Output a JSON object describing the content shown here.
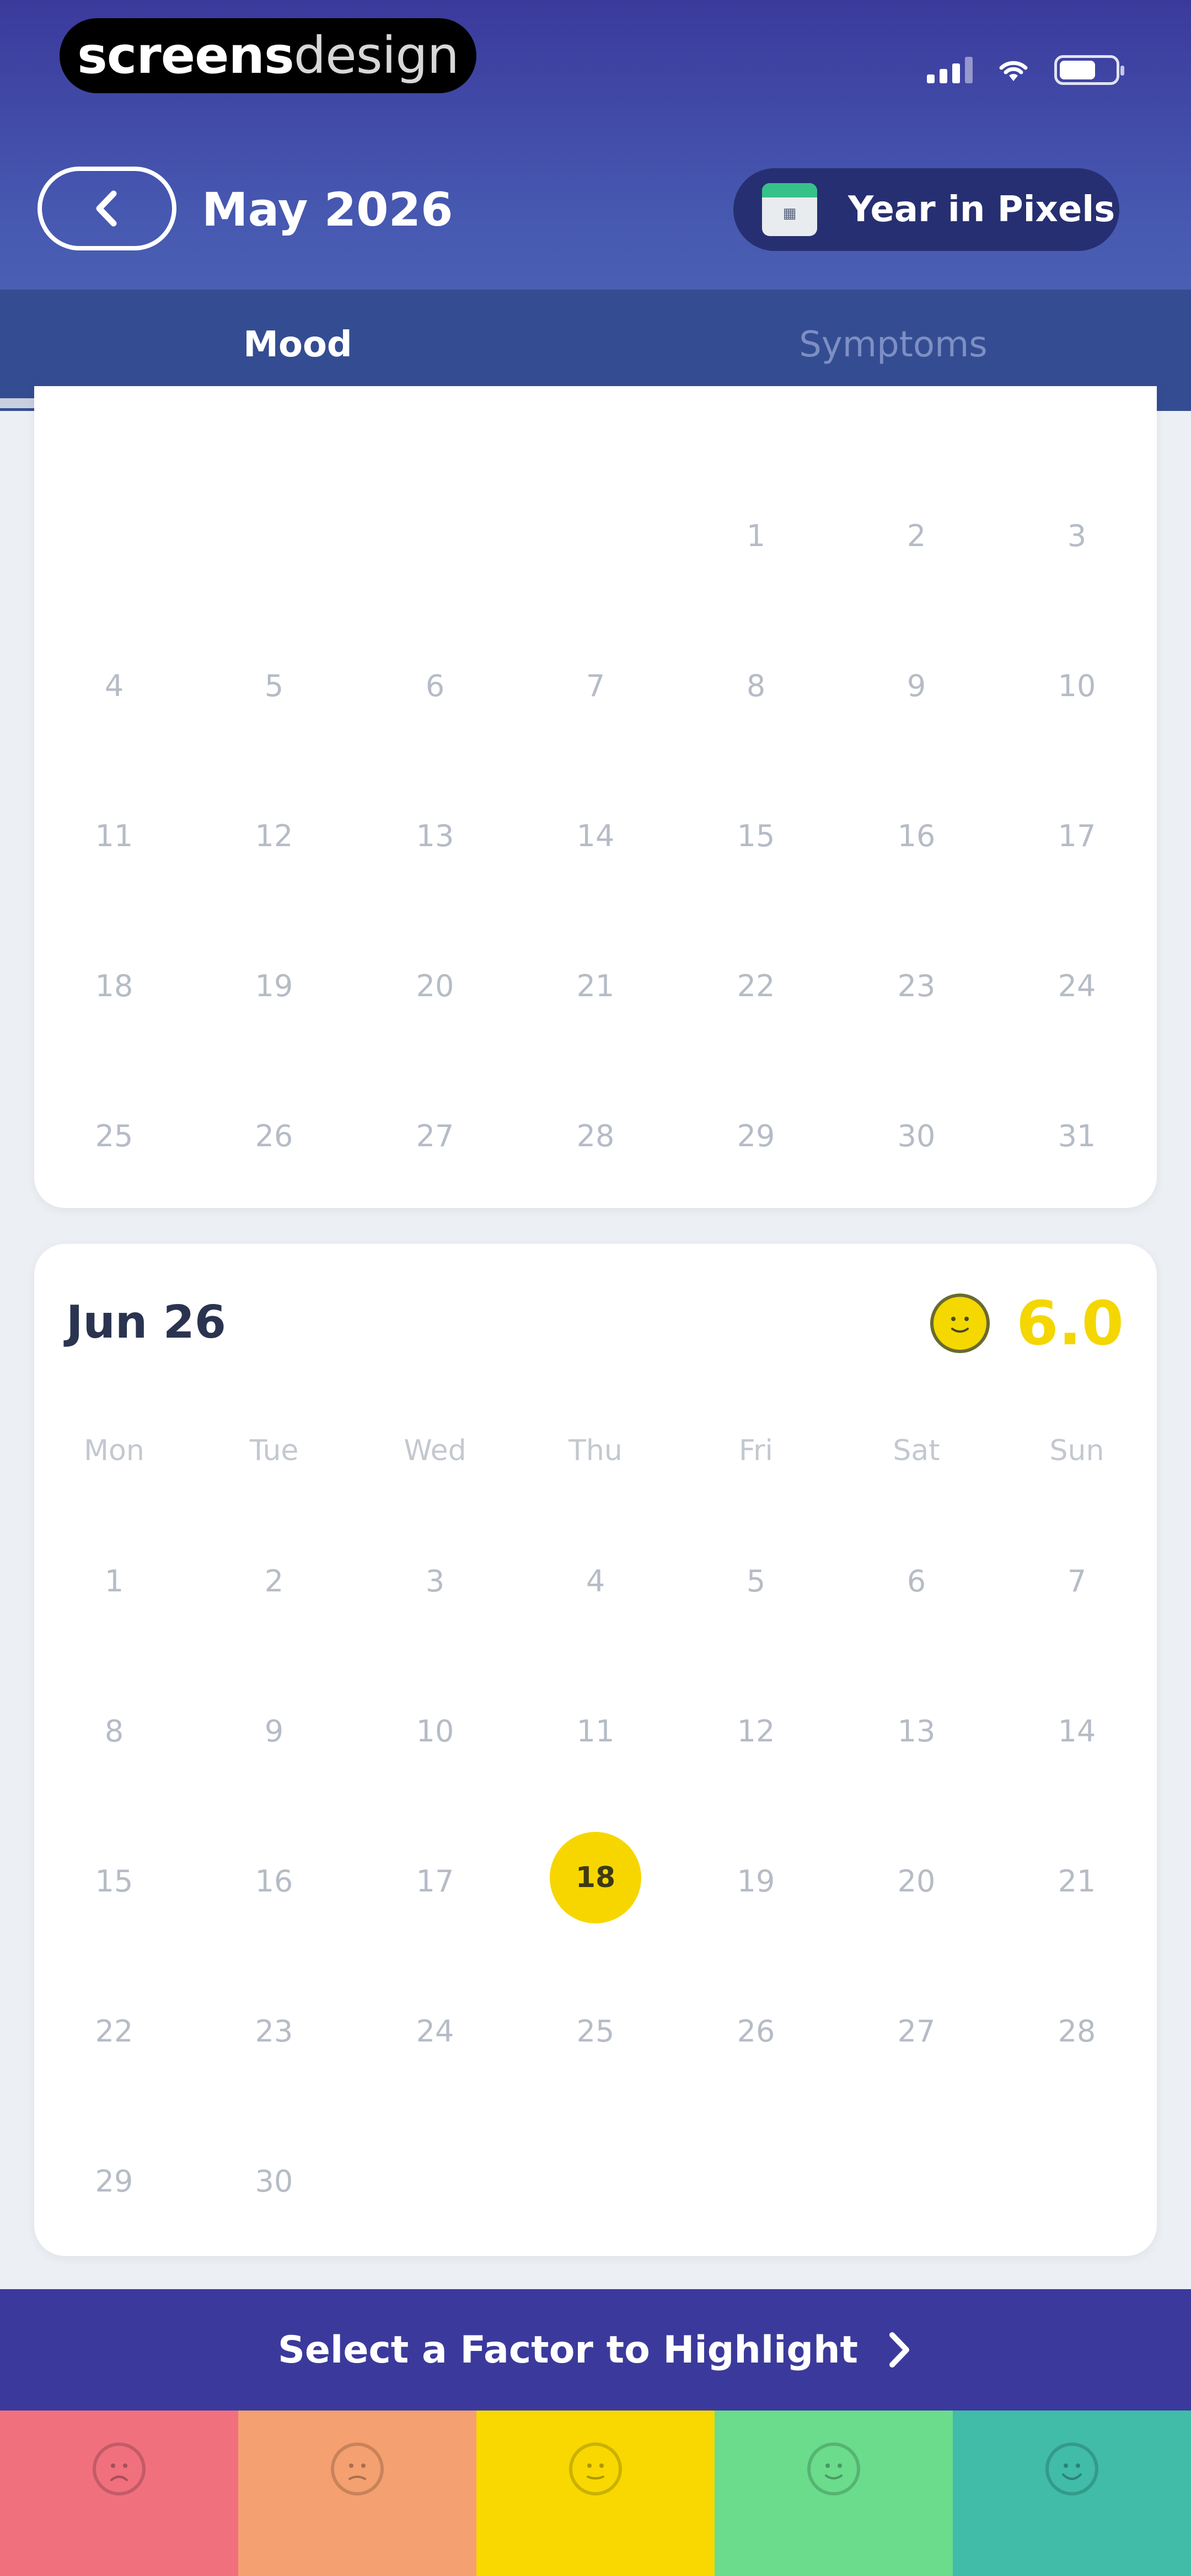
{
  "status_bar": {
    "logo_bold": "screens",
    "logo_light": "design",
    "signal_icon": "signal-icon",
    "wifi_icon": "wifi-icon",
    "battery_icon": "battery-icon"
  },
  "header": {
    "back_icon": "chevron-left-icon",
    "title": "May 2026",
    "pixels_button": {
      "icon": "calendar-icon",
      "label": "Year in Pixels"
    }
  },
  "tabs": [
    {
      "label": "Mood",
      "active": true
    },
    {
      "label": "Symptoms",
      "active": false
    }
  ],
  "may_calendar": {
    "rows": [
      [
        "",
        "",
        "",
        "",
        "1",
        "2",
        "3"
      ],
      [
        "4",
        "5",
        "6",
        "7",
        "8",
        "9",
        "10"
      ],
      [
        "11",
        "12",
        "13",
        "14",
        "15",
        "16",
        "17"
      ],
      [
        "18",
        "19",
        "20",
        "21",
        "22",
        "23",
        "24"
      ],
      [
        "25",
        "26",
        "27",
        "28",
        "29",
        "30",
        "31"
      ]
    ]
  },
  "june_calendar": {
    "title": "Jun 26",
    "average_value": "6.0",
    "average_icon": "neutral-face-icon",
    "weekdays": [
      "Mon",
      "Tue",
      "Wed",
      "Thu",
      "Fri",
      "Sat",
      "Sun"
    ],
    "rows": [
      [
        "1",
        "2",
        "3",
        "4",
        "5",
        "6",
        "7"
      ],
      [
        "8",
        "9",
        "10",
        "11",
        "12",
        "13",
        "14"
      ],
      [
        "15",
        "16",
        "17",
        "18",
        "19",
        "20",
        "21"
      ],
      [
        "22",
        "23",
        "24",
        "25",
        "26",
        "27",
        "28"
      ],
      [
        "29",
        "30",
        "",
        "",
        "",
        "",
        ""
      ]
    ],
    "selected_day": "18"
  },
  "factor_bar": {
    "label": "Select a Factor to Highlight",
    "icon": "chevron-right-icon"
  },
  "mood_scale": [
    {
      "icon": "very-sad-face-icon",
      "color": "#f0707e"
    },
    {
      "icon": "sad-face-icon",
      "color": "#f4a070"
    },
    {
      "icon": "neutral-face-icon",
      "color": "#f8d800"
    },
    {
      "icon": "happy-face-icon",
      "color": "#6adc8c"
    },
    {
      "icon": "very-happy-face-icon",
      "color": "#40bca8"
    }
  ]
}
